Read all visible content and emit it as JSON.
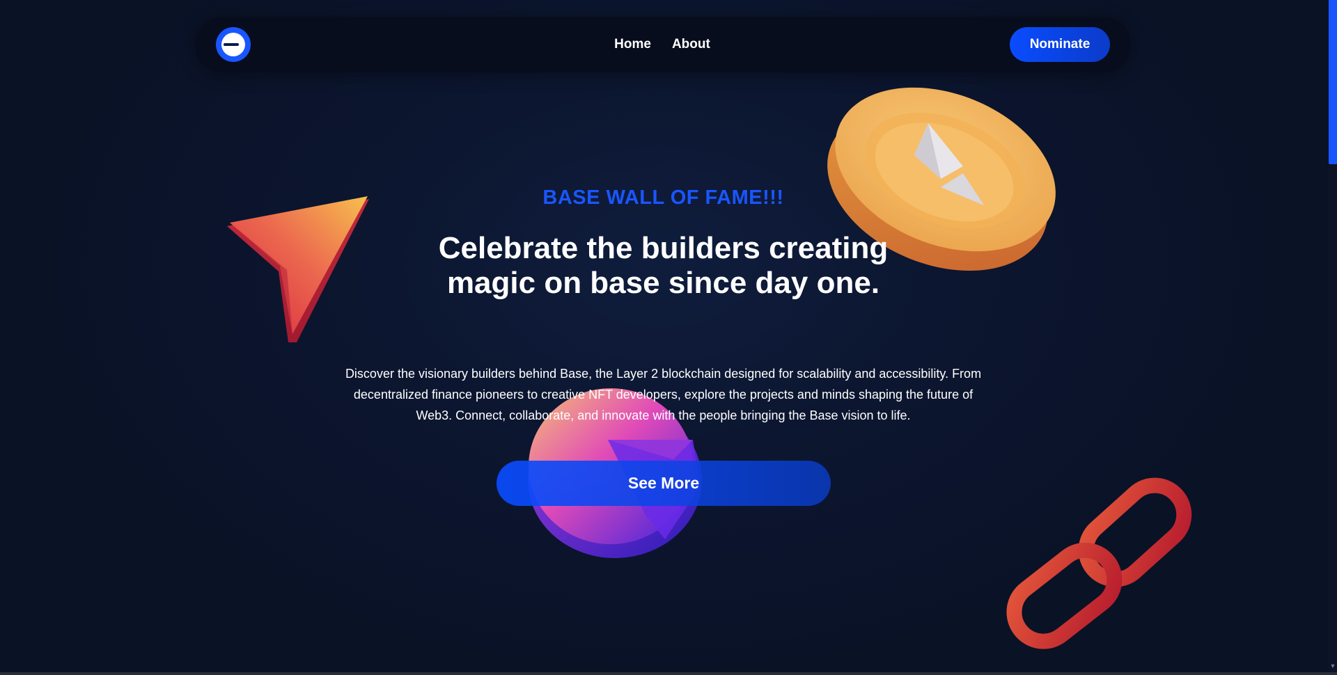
{
  "nav": {
    "logo_icon": "base-logo-icon",
    "links": [
      {
        "label": "Home"
      },
      {
        "label": "About"
      }
    ],
    "nominate_label": "Nominate"
  },
  "hero": {
    "eyebrow": "BASE WALL OF FAME!!!",
    "headline": "Celebrate the builders creating magic on base since day one.",
    "description": "Discover the visionary builders behind Base, the Layer 2 blockchain designed for scalability and accessibility. From decentralized finance pioneers to creative NFT developers, explore the projects and minds shaping the future of Web3. Connect, collaborate, and innovate with the people bringing the Base vision to life.",
    "cta_label": "See More"
  },
  "decorations": [
    {
      "name": "paper-plane-cursor-icon",
      "color_from": "#e8344a",
      "color_to": "#f5b24a"
    },
    {
      "name": "ethereum-coin-icon",
      "color": "#f0a44a"
    },
    {
      "name": "pie-chart-icon",
      "color_from": "#f6b86a",
      "color_to": "#3b1fe0"
    },
    {
      "name": "chain-link-icon",
      "color": "#d9342f"
    }
  ],
  "colors": {
    "background": "#0b1224",
    "accent": "#1a56ff",
    "navbar": "#070d1d",
    "text": "#ffffff"
  }
}
